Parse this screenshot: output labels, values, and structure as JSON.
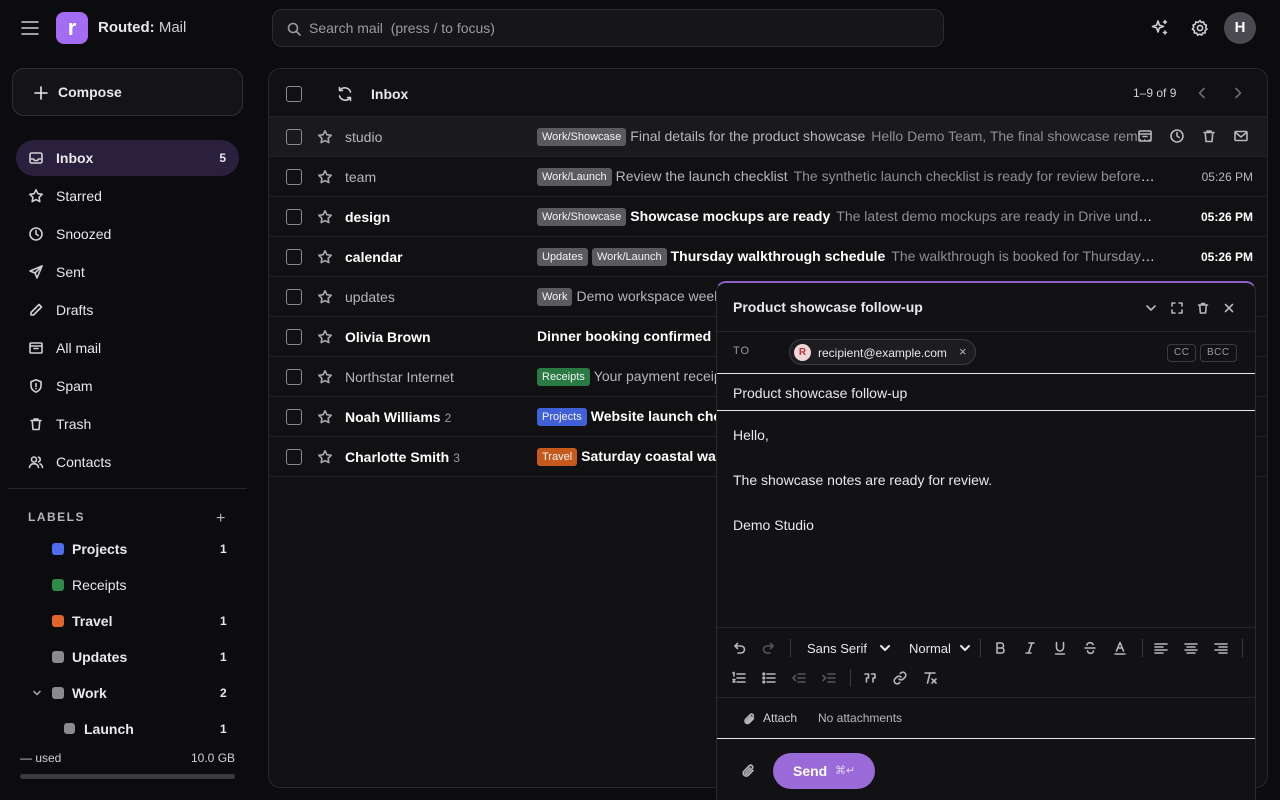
{
  "app": {
    "name": "Routed",
    "suffix": "Mail",
    "logo_letter": "r",
    "accent": "#a46cf2"
  },
  "search": {
    "placeholder": "Search mail  (press / to focus)"
  },
  "user": {
    "initial": "H"
  },
  "sidebar": {
    "compose_label": "Compose",
    "items": [
      {
        "label": "Inbox",
        "count": "5",
        "icon": "inbox-icon",
        "active": true
      },
      {
        "label": "Starred",
        "count": "",
        "icon": "star-icon"
      },
      {
        "label": "Snoozed",
        "count": "",
        "icon": "clock-icon"
      },
      {
        "label": "Sent",
        "count": "",
        "icon": "send-icon"
      },
      {
        "label": "Drafts",
        "count": "",
        "icon": "pencil-icon"
      },
      {
        "label": "All mail",
        "count": "",
        "icon": "archive-icon"
      },
      {
        "label": "Spam",
        "count": "",
        "icon": "shield-icon"
      },
      {
        "label": "Trash",
        "count": "",
        "icon": "trash-icon"
      },
      {
        "label": "Contacts",
        "count": "",
        "icon": "users-icon"
      }
    ],
    "labels_heading": "LABELS",
    "labels": [
      {
        "name": "Projects",
        "count": "1",
        "color": "#4f6cf0"
      },
      {
        "name": "Receipts",
        "count": "",
        "color": "#2e8a4a"
      },
      {
        "name": "Travel",
        "count": "1",
        "color": "#e0652a"
      },
      {
        "name": "Updates",
        "count": "1",
        "color": "#8a8a8f"
      },
      {
        "name": "Work",
        "count": "2",
        "color": "#8a8a8f"
      },
      {
        "name": "Launch",
        "count": "1",
        "color": "#8a8a8f"
      }
    ],
    "storage": {
      "used": "— used",
      "total": "10.0 GB"
    }
  },
  "mail": {
    "folder_title": "Inbox",
    "range": "1–9 of 9",
    "rows": [
      {
        "sender": "studio",
        "thread": "",
        "tags": [
          {
            "t": "Work/Showcase",
            "c": ""
          }
        ],
        "subject": "Final details for the product showcase",
        "snippet": "Hello Demo Team, The final showcase remains scheduled",
        "time": "",
        "unread": false,
        "hover": true
      },
      {
        "sender": "team",
        "thread": "",
        "tags": [
          {
            "t": "Work/Launch",
            "c": ""
          }
        ],
        "subject": "Review the launch checklist",
        "snippet": "The synthetic launch checklist is ready for review before Thursday.",
        "time": "05:26 PM",
        "unread": false
      },
      {
        "sender": "design",
        "thread": "",
        "tags": [
          {
            "t": "Work/Showcase",
            "c": ""
          }
        ],
        "subject": "Showcase mockups are ready",
        "snippet": "The latest demo mockups are ready in Drive under Showcase.",
        "time": "05:26 PM",
        "unread": true
      },
      {
        "sender": "calendar",
        "thread": "",
        "tags": [
          {
            "t": "Updates",
            "c": ""
          },
          {
            "t": "Work/Launch",
            "c": ""
          }
        ],
        "subject": "Thursday walkthrough schedule",
        "snippet": "The walkthrough is booked for Thursday afternoon.",
        "time": "05:26 PM",
        "unread": true
      },
      {
        "sender": "updates",
        "thread": "",
        "tags": [
          {
            "t": "Work",
            "c": ""
          }
        ],
        "subject": "Demo workspace weekly",
        "snippet": "",
        "time": "",
        "unread": false
      },
      {
        "sender": "Olivia Brown",
        "thread": "",
        "tags": [],
        "subject": "Dinner booking confirmed",
        "snippet": "",
        "time": "",
        "unread": true
      },
      {
        "sender": "Northstar Internet",
        "thread": "",
        "tags": [
          {
            "t": "Receipts",
            "c": "green"
          }
        ],
        "subject": "Your payment receipt",
        "snippet": "",
        "time": "",
        "unread": false
      },
      {
        "sender": "Noah Williams",
        "thread": "2",
        "tags": [
          {
            "t": "Projects",
            "c": "blue"
          }
        ],
        "subject": "Website launch checklist",
        "snippet": "",
        "time": "",
        "unread": true
      },
      {
        "sender": "Charlotte Smith",
        "thread": "3",
        "tags": [
          {
            "t": "Travel",
            "c": "orange"
          }
        ],
        "subject": "Saturday coastal walk",
        "snippet": "",
        "time": "",
        "unread": true
      }
    ]
  },
  "compose": {
    "title": "Product showcase follow-up",
    "to_label": "TO",
    "recipient": "recipient@example.com",
    "recipient_initial": "R",
    "cc": "CC",
    "bcc": "BCC",
    "subject": "Product showcase follow-up",
    "body": [
      "Hello,",
      "The showcase notes are ready for review.",
      "Demo Studio"
    ],
    "font": "Sans Serif",
    "size": "Normal",
    "attach": "Attach",
    "attachments": "No attachments",
    "send": "Send",
    "send_shortcut": "⌘↵"
  }
}
